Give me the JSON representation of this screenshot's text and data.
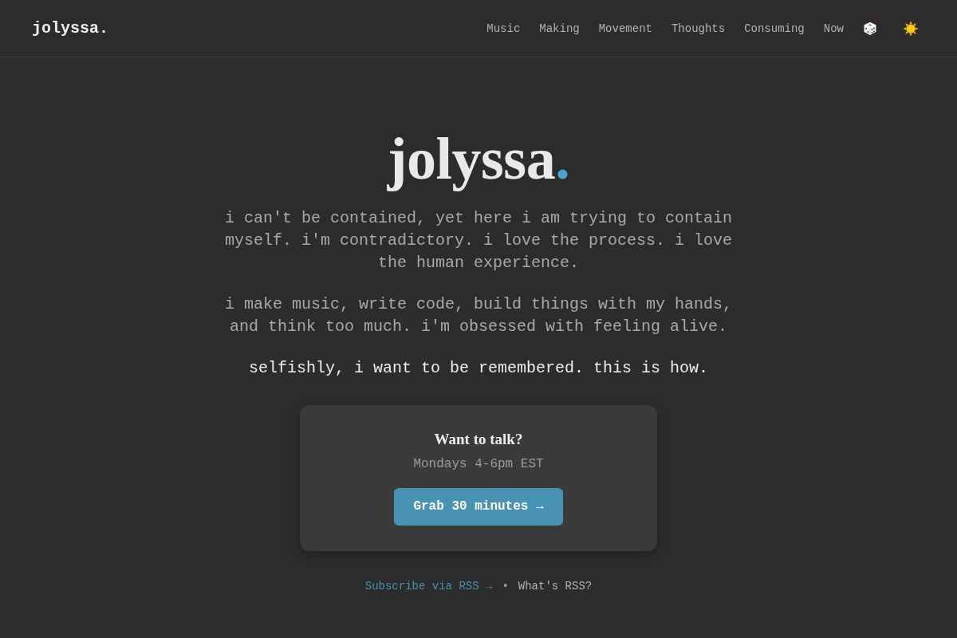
{
  "header": {
    "logo": "jolyssa.",
    "nav": [
      "Music",
      "Making",
      "Movement",
      "Thoughts",
      "Consuming",
      "Now"
    ]
  },
  "hero": {
    "title": "jolyssa",
    "title_accent": ".",
    "paragraphs": [
      {
        "kind": "body",
        "text": "i can't be contained, yet here i am trying to contain myself. i'm contradictory. i love the process. i love the human experience."
      },
      {
        "kind": "body",
        "text": "i make music, write code, build things with my hands, and think too much. i'm obsessed with feeling alive."
      },
      {
        "kind": "statement",
        "text": "selfishly, i want to be remembered. this is how."
      }
    ]
  },
  "contact_card": {
    "title": "Want to talk?",
    "hours": "Mondays 4-6pm EST",
    "button": "Grab 30 minutes →"
  },
  "footer": {
    "rss_link": "Subscribe via RSS →",
    "separator": "•",
    "rss_help_link": "What's RSS?"
  }
}
